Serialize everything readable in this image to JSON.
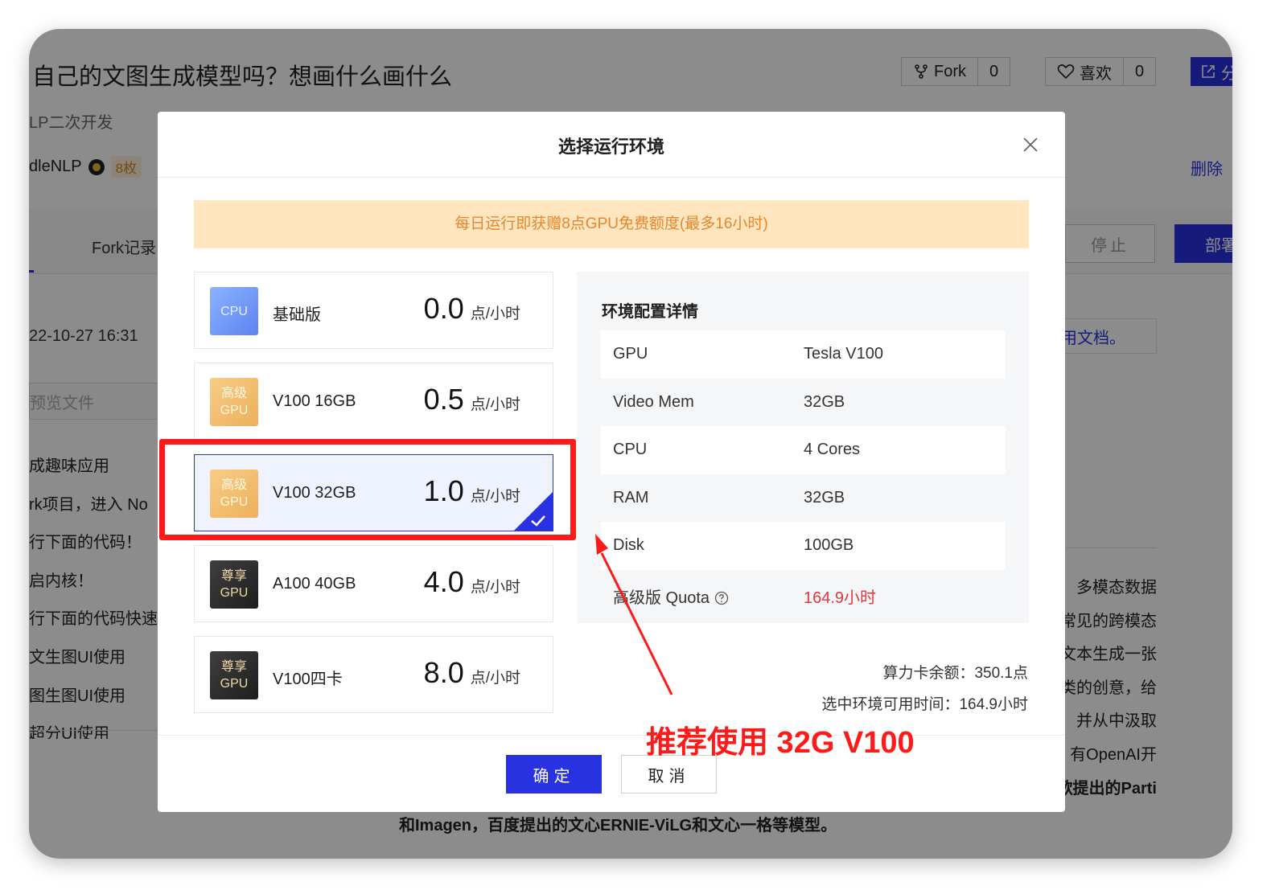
{
  "background": {
    "title": "自己的文图生成模型吗？想画什么画什么",
    "subtitle": "LP二次开发",
    "author": "dleNLP",
    "badge": "8枚",
    "fork_label": "Fork",
    "fork_count": "0",
    "like_label": "喜欢",
    "like_count": "0",
    "share_label": "分",
    "delete_label": "删除",
    "fork_records_tab": "Fork记录",
    "stop_button": "停止",
    "deploy_button": "部署",
    "date": "22-10-27 16:31",
    "preview_file": "预览文件",
    "doc_link": "用文档。",
    "left_toc": [
      "成趣味应用",
      "rk项目，进入 No",
      "行下面的代码！",
      "启内核！",
      "行下面的代码快速",
      "文生图UI使用",
      "图生图UI使用",
      "超分UI使用"
    ],
    "right_text": [
      "多模态数据",
      "常见的跨模态",
      "文本生成一张",
      "类的创意，给",
      "并从中汲取",
      "有OpenAI开",
      "歌提出的Parti"
    ],
    "bottom_text": "和Imagen，百度提出的文心ERNIE-ViLG和文心一格等模型。"
  },
  "modal": {
    "title": "选择运行环境",
    "notice": "每日运行即获赠8点GPU免费额度(最多16小时)",
    "unit": "点/小时",
    "plans": [
      {
        "icon_line1": "CPU",
        "icon_line2": "",
        "name": "基础版",
        "price": "0.0",
        "tier": "cpu"
      },
      {
        "icon_line1": "高级",
        "icon_line2": "GPU",
        "name": "V100 16GB",
        "price": "0.5",
        "tier": "adv"
      },
      {
        "icon_line1": "高级",
        "icon_line2": "GPU",
        "name": "V100 32GB",
        "price": "1.0",
        "tier": "adv",
        "selected": true
      },
      {
        "icon_line1": "尊享",
        "icon_line2": "GPU",
        "name": "A100 40GB",
        "price": "4.0",
        "tier": "vip"
      },
      {
        "icon_line1": "尊享",
        "icon_line2": "GPU",
        "name": "V100四卡",
        "price": "8.0",
        "tier": "vip"
      }
    ],
    "details": {
      "title": "环境配置详情",
      "rows": [
        {
          "key": "GPU",
          "value": "Tesla V100"
        },
        {
          "key": "Video Mem",
          "value": "32GB"
        },
        {
          "key": "CPU",
          "value": "4 Cores"
        },
        {
          "key": "RAM",
          "value": "32GB"
        },
        {
          "key": "Disk",
          "value": "100GB"
        },
        {
          "key": "高级版 Quota",
          "value": "164.9小时"
        }
      ]
    },
    "balance": "算力卡余额：350.1点",
    "available_time": "选中环境可用时间：164.9小时",
    "confirm": "确定",
    "cancel": "取消"
  },
  "annotation": {
    "text": "推荐使用 32G V100",
    "color": "#ff1a1a"
  },
  "colors": {
    "primary": "#2932e1",
    "notice_bg": "#ffe6bf",
    "notice_text": "#e8862c",
    "quota_red": "#e0383e"
  }
}
